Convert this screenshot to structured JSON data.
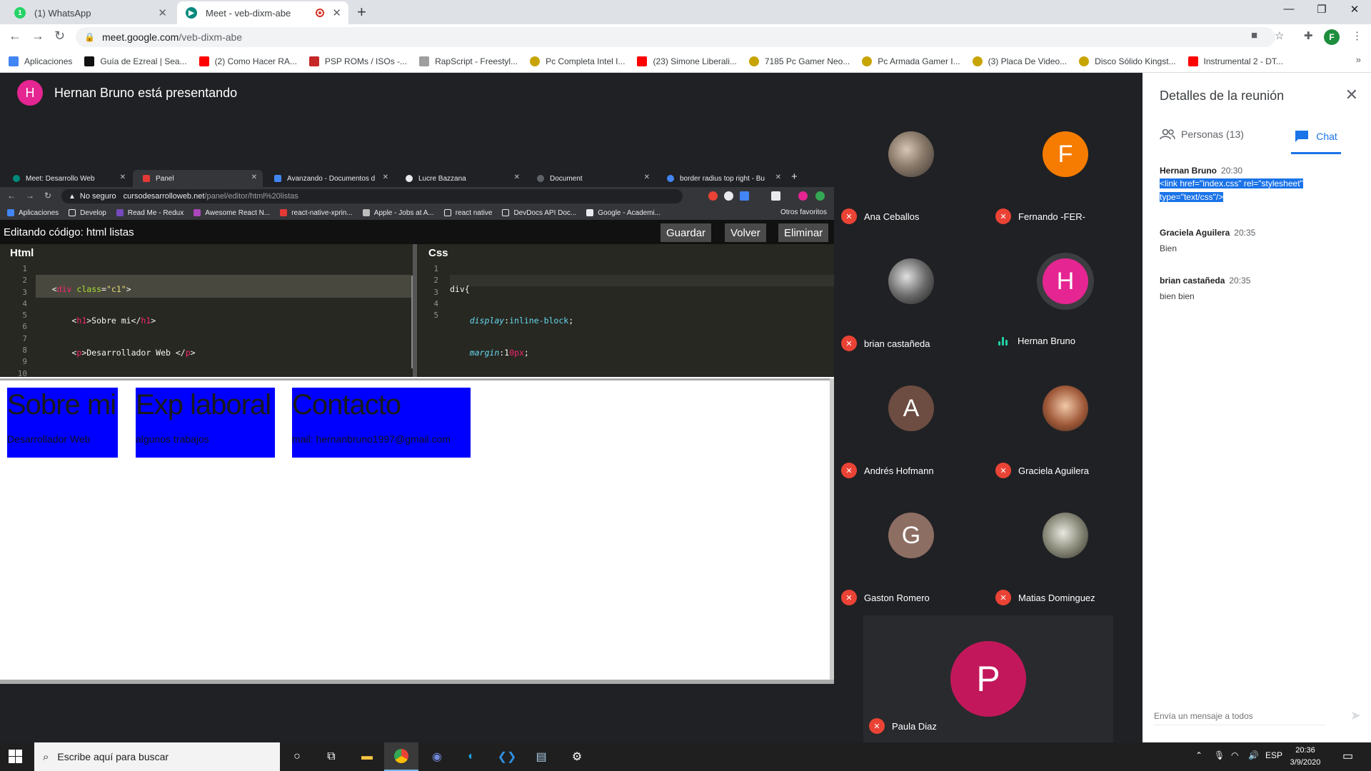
{
  "browser": {
    "tabs": [
      {
        "title": "(1) WhatsApp",
        "favicon": "whatsapp-icon"
      },
      {
        "title": "Meet - veb-dixm-abe",
        "favicon": "meet-icon"
      }
    ],
    "url_host": "meet.google.com",
    "url_path": "/veb-dixm-abe",
    "profile_initial": "F",
    "bookmarks": [
      {
        "label": "Aplicaciones",
        "color": "#4285f4"
      },
      {
        "label": "Guía de Ezreal | Sea...",
        "color": "#111111"
      },
      {
        "label": "(2) Como Hacer RA...",
        "color": "#ff0000"
      },
      {
        "label": "PSP ROMs / ISOs -...",
        "color": "#c62828"
      },
      {
        "label": "RapScript - Freestyl...",
        "color": "#9e9e9e"
      },
      {
        "label": "Pc Completa Intel I...",
        "color": "#c8a400"
      },
      {
        "label": "(23) Simone Liberali...",
        "color": "#ff0000"
      },
      {
        "label": "7185 Pc Gamer Neo...",
        "color": "#c8a400"
      },
      {
        "label": "Pc Armada Gamer I...",
        "color": "#c8a400"
      },
      {
        "label": "(3) Placa De Video...",
        "color": "#c8a400"
      },
      {
        "label": "Disco Sólido Kingst...",
        "color": "#c8a400"
      },
      {
        "label": "Instrumental 2 - DT...",
        "color": "#ff0000"
      }
    ]
  },
  "meet": {
    "presenter_initial": "H",
    "presenter_text": "Hernan Bruno está presentando",
    "participants": [
      {
        "name": "Ana Ceballos",
        "initial": "",
        "avatar": "photo",
        "muted": true
      },
      {
        "name": "Fernando -FER-",
        "initial": "F",
        "avatar": "#f57c00",
        "muted": true
      },
      {
        "name": "brian castañeda",
        "initial": "",
        "avatar": "photo",
        "muted": true
      },
      {
        "name": "Hernan Bruno",
        "initial": "H",
        "avatar": "#e52592",
        "muted": false
      },
      {
        "name": "Andrés Hofmann",
        "initial": "A",
        "avatar": "#6d4c41",
        "muted": true
      },
      {
        "name": "Graciela Aguilera",
        "initial": "",
        "avatar": "photo",
        "muted": true
      },
      {
        "name": "Gaston Romero",
        "initial": "G",
        "avatar": "#8d6e63",
        "muted": true
      },
      {
        "name": "Matias Dominguez",
        "initial": "",
        "avatar": "photo",
        "muted": true
      }
    ],
    "featured": {
      "name": "Paula Diaz",
      "initial": "P"
    }
  },
  "shared_screen": {
    "tabs": [
      "Meet: Desarrollo Web",
      "Panel",
      "Avanzando - Documentos d",
      "Lucre Bazzana",
      "Document",
      "border radius top right - Bu"
    ],
    "not_secure_label": "No seguro",
    "url_host": "cursodesarrolloweb.net",
    "url_path": "/panel/editor/html%20listas",
    "bookmarks": [
      "Aplicaciones",
      "Develop",
      "Read Me - Redux",
      "Awesome React N...",
      "react-native-xprin...",
      "Apple - Jobs at A...",
      "react native",
      "DevDocs API Doc...",
      "Google - Academi..."
    ],
    "other_bookmarks": "Otros favoritos",
    "editor_title": "Editando código: html listas",
    "buttons": {
      "save": "Guardar",
      "back": "Volver",
      "delete": "Eliminar"
    },
    "html_pane_title": "Html",
    "css_pane_title": "Css",
    "html_line_numbers": [
      "1",
      "2",
      "3",
      "4",
      "5",
      "6",
      "7",
      "8",
      "9",
      "10"
    ],
    "css_line_numbers": [
      "1",
      "2",
      "3",
      "4",
      "5"
    ],
    "preview": [
      {
        "heading": "Sobre mi",
        "text": "Desarrollador Web"
      },
      {
        "heading": "Exp laboral",
        "text": "algunos trabajos"
      },
      {
        "heading": "Contacto",
        "text": "mail: hernanbruno1997@gmail.com"
      }
    ]
  },
  "side_panel": {
    "title": "Detalles de la reunión",
    "people_tab": "Personas (13)",
    "chat_tab": "Chat",
    "messages": [
      {
        "sender": "Hernan Bruno",
        "time": "20:30",
        "text": "<link href=\"index.css\" rel=\"stylesheet\" type=\"text/css\"/>"
      },
      {
        "sender": "Graciela Aguilera",
        "time": "20:35",
        "text": "Bien"
      },
      {
        "sender": "brian castañeda",
        "time": "20:35",
        "text": "bien bien"
      }
    ],
    "input_placeholder": "Envía un mensaje a todos"
  },
  "taskbar": {
    "search_placeholder": "Escribe aquí para buscar",
    "language": "ESP",
    "time": "20:36",
    "date": "3/9/2020"
  }
}
